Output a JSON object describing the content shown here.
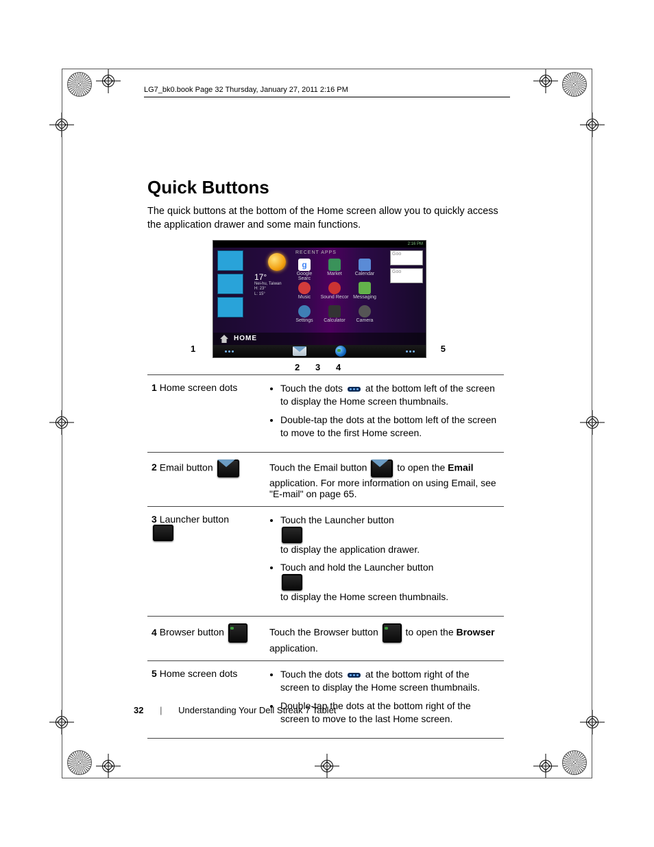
{
  "header": "LG7_bk0.book  Page 32  Thursday, January 27, 2011  2:16 PM",
  "title": "Quick Buttons",
  "intro": "The quick buttons at the bottom of the Home screen allow you to quickly access the application drawer and some main functions.",
  "screenshot": {
    "status_time": "2:16 PM",
    "recent_label": "RECENT APPS",
    "weather": {
      "temp": "17°",
      "loc": "Nei-hu, Taiwan",
      "hi": "H:  23°",
      "lo": "L:   15°"
    },
    "apps": [
      "Google Searc",
      "Market",
      "Calendar",
      "Music",
      "Sound Recor",
      "Messaging",
      "Settings",
      "Calculator",
      "Camera"
    ],
    "home_label": "HOME",
    "google_hint": "Goo",
    "callouts": {
      "left": "1",
      "right": "5",
      "c2": "2",
      "c3": "3",
      "c4": "4"
    }
  },
  "rows": [
    {
      "num": "1",
      "label": "Home screen dots",
      "icon": null,
      "desc": {
        "type": "list",
        "items": [
          {
            "pre": "Touch the dots ",
            "icon": "dots",
            "post": " at the bottom left of the screen to display the Home screen thumbnails."
          },
          {
            "pre": "Double-tap the dots at the bottom left of the screen to move to the first Home screen.",
            "icon": null,
            "post": ""
          }
        ]
      }
    },
    {
      "num": "2",
      "label": "Email button",
      "icon": "mail",
      "desc": {
        "type": "para",
        "pre": "Touch the Email button ",
        "icon": "mail",
        "post1": " to open the ",
        "bold": "Email",
        "post2": " application. For more information on using Email, see \"E-mail\" on page 65."
      }
    },
    {
      "num": "3",
      "label": "Launcher button",
      "icon": "grid",
      "desc": {
        "type": "list",
        "items": [
          {
            "pre": "Touch the Launcher button ",
            "icon": "grid",
            "post": " to display the application drawer."
          },
          {
            "pre": "Touch and hold the Launcher button ",
            "icon": "grid",
            "post": " to display the Home screen thumbnails."
          }
        ]
      }
    },
    {
      "num": "4",
      "label": "Browser button",
      "icon": "globe",
      "desc": {
        "type": "para",
        "pre": "Touch the Browser button ",
        "icon": "globe",
        "post1": " to open the ",
        "bold": "Browser",
        "post2": " application."
      }
    },
    {
      "num": "5",
      "label": "Home screen dots",
      "icon": null,
      "desc": {
        "type": "list",
        "items": [
          {
            "pre": "Touch the dots ",
            "icon": "dots",
            "post": " at the bottom right of the screen to display the Home screen thumbnails."
          },
          {
            "pre": "Double-tap the dots at the bottom right of the screen to move to the last Home screen.",
            "icon": null,
            "post": ""
          }
        ]
      }
    }
  ],
  "footer": {
    "page": "32",
    "chapter": "Understanding Your Dell Streak 7 Tablet"
  }
}
